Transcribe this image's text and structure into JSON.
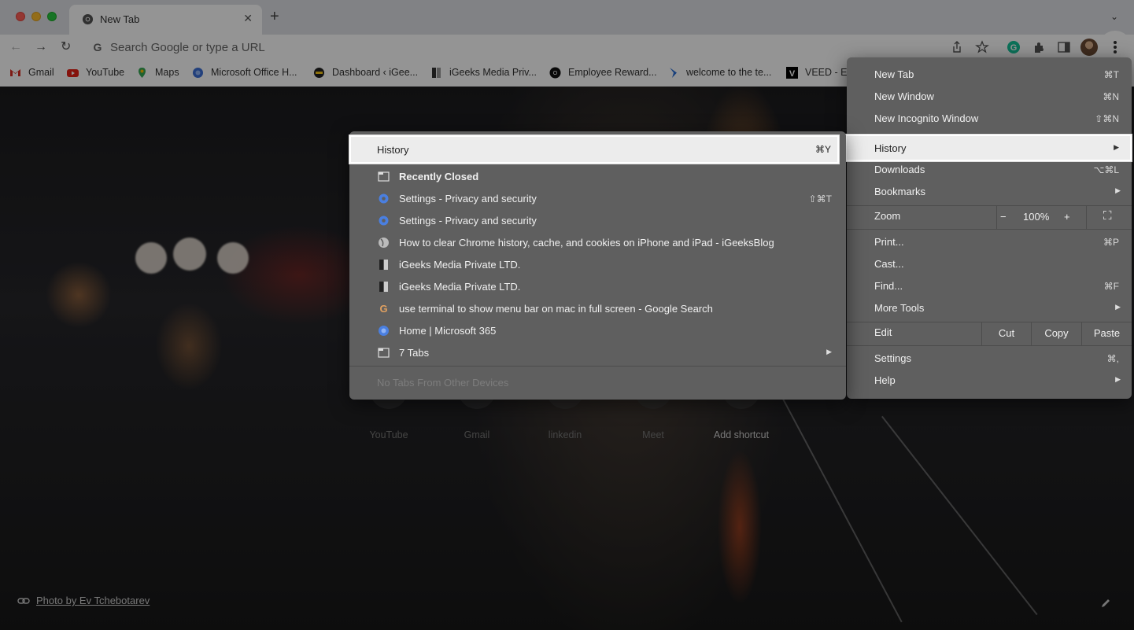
{
  "window": {
    "tab_title": "New Tab",
    "tab_close": "✕",
    "new_tab": "+",
    "tab_search": "⌄"
  },
  "toolbar": {
    "back": "←",
    "forward": "→",
    "reload": "↻",
    "search_placeholder": "Search Google or type a URL"
  },
  "bookmarks": [
    {
      "label": "Gmail",
      "icon": "gmail-icon"
    },
    {
      "label": "YouTube",
      "icon": "youtube-icon"
    },
    {
      "label": "Maps",
      "icon": "maps-icon"
    },
    {
      "label": "Microsoft Office H...",
      "icon": "office-icon"
    },
    {
      "label": "Dashboard ‹ iGee...",
      "icon": "dashboard-icon"
    },
    {
      "label": "iGeeks Media Priv...",
      "icon": "igeeks-icon"
    },
    {
      "label": "Employee Reward...",
      "icon": "employee-icon"
    },
    {
      "label": "welcome to the te...",
      "icon": "welcome-icon"
    },
    {
      "label": "VEED - E",
      "icon": "veed-icon"
    }
  ],
  "shortcuts": [
    "YouTube",
    "Gmail",
    "linkedin",
    "Meet",
    "Add shortcut"
  ],
  "photo_credit": "Photo by Ev Tchebotarev",
  "main_menu": {
    "new_tab": {
      "label": "New Tab",
      "shortcut": "⌘T"
    },
    "new_window": {
      "label": "New Window",
      "shortcut": "⌘N"
    },
    "new_incognito": {
      "label": "New Incognito Window",
      "shortcut": "⇧⌘N"
    },
    "history": {
      "label": "History"
    },
    "downloads": {
      "label": "Downloads",
      "shortcut": "⌥⌘L"
    },
    "bookmarks": {
      "label": "Bookmarks"
    },
    "zoom": {
      "label": "Zoom",
      "minus": "−",
      "value": "100%",
      "plus": "+",
      "fullscreen": "⛶"
    },
    "print": {
      "label": "Print...",
      "shortcut": "⌘P"
    },
    "cast": {
      "label": "Cast..."
    },
    "find": {
      "label": "Find...",
      "shortcut": "⌘F"
    },
    "more_tools": {
      "label": "More Tools"
    },
    "edit": {
      "label": "Edit",
      "cut": "Cut",
      "copy": "Copy",
      "paste": "Paste"
    },
    "settings": {
      "label": "Settings",
      "shortcut": "⌘,"
    },
    "help": {
      "label": "Help"
    }
  },
  "history_menu": {
    "header": {
      "label": "History",
      "shortcut": "⌘Y"
    },
    "recently_closed": "Recently Closed",
    "items": [
      {
        "label": "Settings - Privacy and security",
        "shortcut": "⇧⌘T",
        "icon": "settings-gear-icon"
      },
      {
        "label": "Settings - Privacy and security",
        "shortcut": "",
        "icon": "settings-gear-icon"
      },
      {
        "label": "How to clear Chrome history, cache, and cookies on iPhone and iPad - iGeeksBlog",
        "shortcut": "",
        "icon": "globe-icon"
      },
      {
        "label": "iGeeks Media Private LTD.",
        "shortcut": "",
        "icon": "igeeks-icon"
      },
      {
        "label": "iGeeks Media Private LTD.",
        "shortcut": "",
        "icon": "igeeks-icon"
      },
      {
        "label": "use terminal to show menu bar on mac in full screen - Google Search",
        "shortcut": "",
        "icon": "google-icon"
      },
      {
        "label": "Home | Microsoft 365",
        "shortcut": "",
        "icon": "office-icon"
      },
      {
        "label": "7 Tabs",
        "shortcut": "",
        "icon": "folder-icon"
      }
    ],
    "no_tabs": "No Tabs From Other Devices"
  }
}
